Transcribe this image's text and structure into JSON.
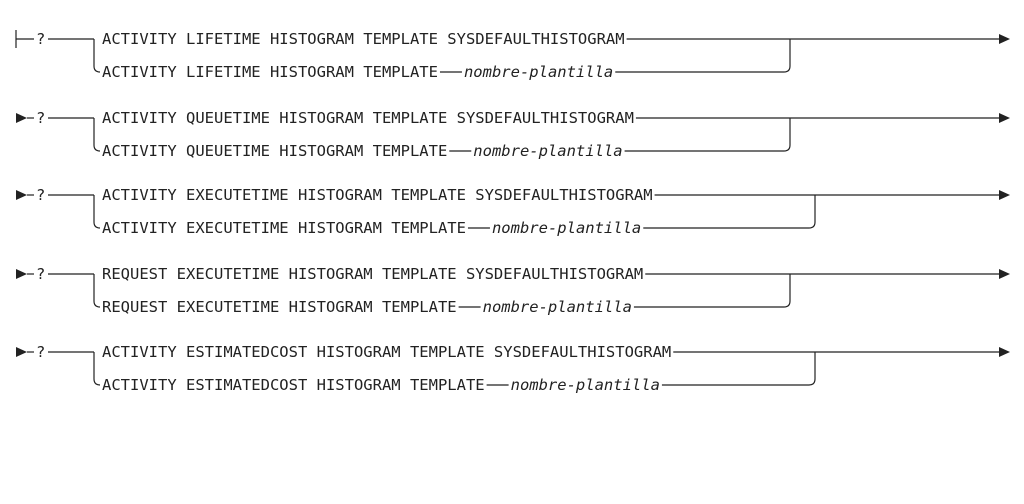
{
  "diagram": {
    "start_marker": "├",
    "continuation_marker": "►",
    "repeat_marker": "?",
    "rows": [
      {
        "default_clause": "ACTIVITY LIFETIME HISTOGRAM TEMPLATE SYSDEFAULTHISTOGRAM",
        "alt_keywords": "ACTIVITY LIFETIME HISTOGRAM TEMPLATE",
        "alt_variable": "nombre-plantilla"
      },
      {
        "default_clause": "ACTIVITY QUEUETIME HISTOGRAM TEMPLATE SYSDEFAULTHISTOGRAM",
        "alt_keywords": "ACTIVITY QUEUETIME HISTOGRAM TEMPLATE",
        "alt_variable": "nombre-plantilla"
      },
      {
        "default_clause": "ACTIVITY EXECUTETIME HISTOGRAM TEMPLATE SYSDEFAULTHISTOGRAM",
        "alt_keywords": "ACTIVITY EXECUTETIME HISTOGRAM TEMPLATE",
        "alt_variable": "nombre-plantilla"
      },
      {
        "default_clause": "REQUEST EXECUTETIME HISTOGRAM TEMPLATE SYSDEFAULTHISTOGRAM",
        "alt_keywords": "REQUEST EXECUTETIME HISTOGRAM TEMPLATE",
        "alt_variable": "nombre-plantilla"
      },
      {
        "default_clause": "ACTIVITY ESTIMATEDCOST HISTOGRAM TEMPLATE SYSDEFAULTHISTOGRAM",
        "alt_keywords": "ACTIVITY ESTIMATEDCOST HISTOGRAM TEMPLATE",
        "alt_variable": "nombre-plantilla"
      }
    ]
  }
}
